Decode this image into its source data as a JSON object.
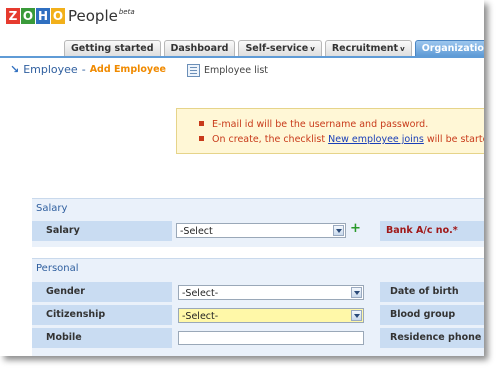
{
  "logo": {
    "letters": [
      "Z",
      "O",
      "H",
      "O"
    ],
    "product": "People",
    "badge": "beta"
  },
  "tabs": [
    {
      "label": "Getting started"
    },
    {
      "label": "Dashboard"
    },
    {
      "label": "Self-service",
      "caret": "v"
    },
    {
      "label": "Recruitment",
      "caret": "v"
    },
    {
      "label": "Organization",
      "caret": "v"
    }
  ],
  "breadcrumb": {
    "section": "Employee",
    "sep": "-",
    "page": "Add Employee"
  },
  "employee_list": "Employee list",
  "notice": {
    "line1": "E-mail id will be the username and password.",
    "line2_pre": "On create, the checklist ",
    "line2_link": "New employee joins",
    "line2_post": " will be started."
  },
  "salary": {
    "title": "Salary",
    "salary_label": "Salary",
    "salary_value": "-Select",
    "bank_label": "Bank A/c no.*"
  },
  "personal": {
    "title": "Personal",
    "gender_label": "Gender",
    "gender_value": "-Select-",
    "dob_label": "Date of birth",
    "citizenship_label": "Citizenship",
    "citizenship_value": "-Select-",
    "blood_label": "Blood group",
    "mobile_label": "Mobile",
    "residence_label": "Residence phone"
  },
  "colors": {
    "accent": "#5f9bd6",
    "section_bg": "#eaf1fa",
    "label_bg": "#c9dcf2",
    "notice_bg": "#fff7d6"
  }
}
